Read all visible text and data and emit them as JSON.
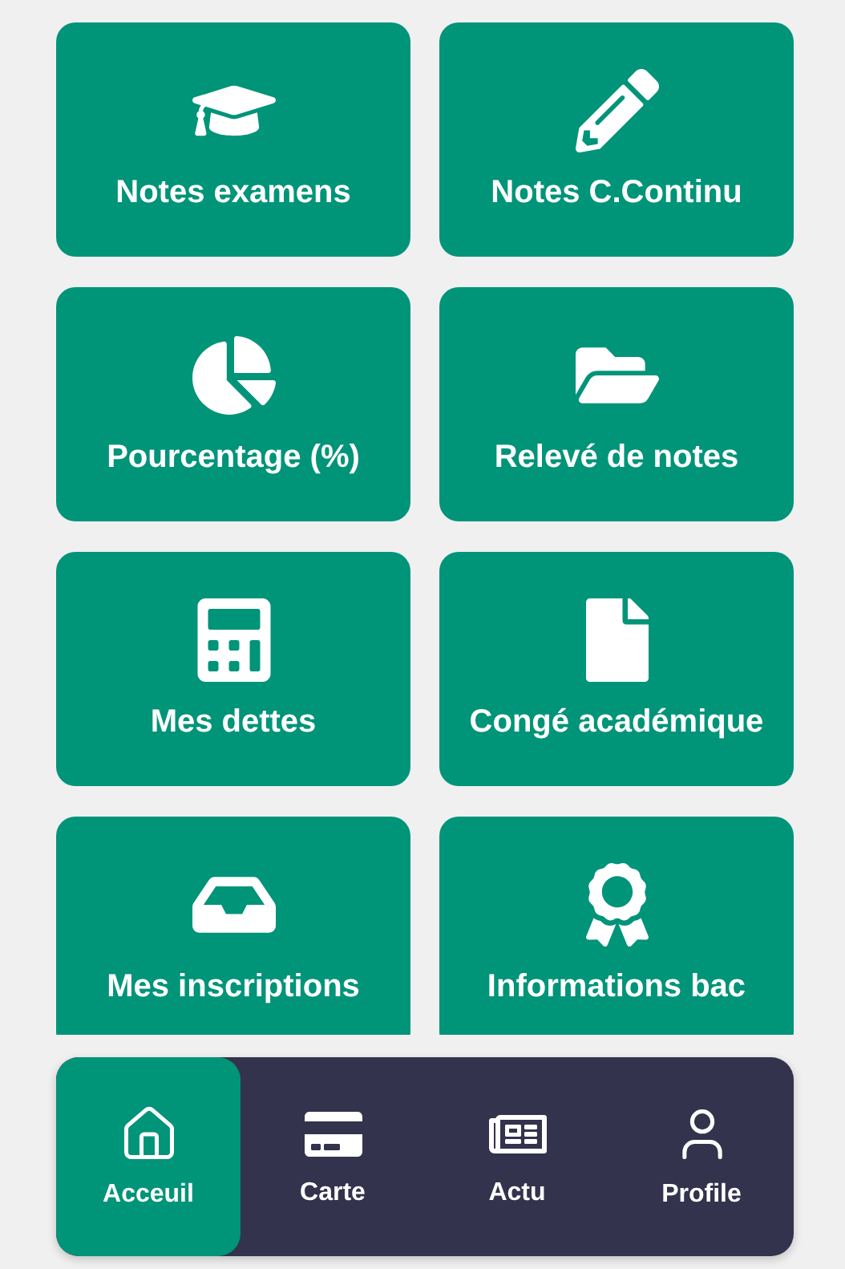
{
  "tiles": [
    {
      "label": "Notes examens"
    },
    {
      "label": "Notes C.Continu"
    },
    {
      "label": "Pourcentage (%)"
    },
    {
      "label": "Relevé de notes"
    },
    {
      "label": "Mes dettes"
    },
    {
      "label": "Congé académique"
    },
    {
      "label": "Mes inscriptions"
    },
    {
      "label": "Informations bac"
    }
  ],
  "nav": [
    {
      "label": "Acceuil",
      "selected": true
    },
    {
      "label": "Carte",
      "selected": false
    },
    {
      "label": "Actu",
      "selected": false
    },
    {
      "label": "Profile",
      "selected": false
    }
  ]
}
